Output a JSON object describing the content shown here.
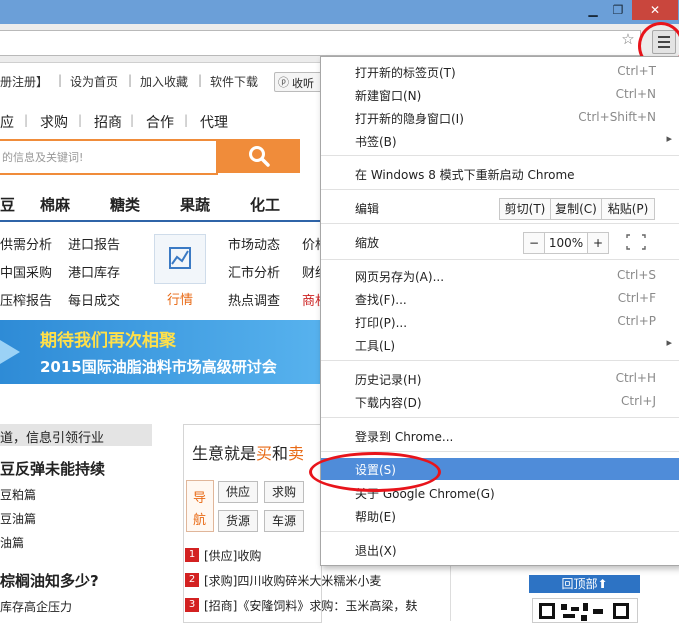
{
  "window": {
    "minimize_icon": "minimize-icon",
    "maximize_icon": "restore-icon",
    "close_label": "✕",
    "restore_label": "❐",
    "minimize_label": "▁"
  },
  "toolbar": {
    "star_label": "☆"
  },
  "site": {
    "top_nav": [
      "册注册】",
      "设为首页",
      "加入收藏",
      "软件下载",
      "收听"
    ],
    "top_nav_seps": [
      "|",
      "|",
      "|"
    ],
    "categories": [
      "应",
      "求购",
      "招商",
      "合作",
      "代理"
    ],
    "search_placeholder": "的信息及关键词!",
    "goods_tabs": [
      "豆",
      "棉麻",
      "糖类",
      "果蔬",
      "化工"
    ],
    "subnav_col1": [
      "供需分析",
      "中国采购",
      "压榨报告"
    ],
    "subnav_col2": [
      "进口报告",
      "港口库存",
      "每日成交"
    ],
    "subnav_col3": [
      "市场动态",
      "汇市分析",
      "热点调查"
    ],
    "subnav_col4": [
      "价格",
      "财经",
      "商机"
    ],
    "quotes_label": "行情",
    "banner_line1": "期待我们再次相聚",
    "banner_line2": "2015国际油脂油料市场高级研讨会",
    "info_strip": "道，信息引领行业",
    "news": [
      {
        "head": "豆反弹未能持续",
        "items": [
          "豆粕篇",
          "豆油篇",
          "油篇"
        ]
      },
      {
        "head": "棕榈油知多少?",
        "items": [
          "库存高企压力"
        ]
      }
    ],
    "biz_title_pre": "生意就是",
    "biz_title_hl1": "买",
    "biz_title_mid": "和",
    "biz_title_hl2": "卖",
    "nav_tag": [
      "导",
      "航"
    ],
    "tag_buttons": [
      "供应",
      "求购",
      "货源",
      "车源"
    ],
    "supply_list": [
      {
        "num": "1",
        "text": "[供应]收购"
      },
      {
        "num": "2",
        "text": "[求购]四川收购碎米大米糯米小麦"
      },
      {
        "num": "3",
        "text": "[招商]《安隆饲料》求购：玉米高梁，麸"
      }
    ],
    "back_top": "回顶部⬆"
  },
  "menu": {
    "items": [
      {
        "label": "打开新的标签页(T)",
        "shortcut": "Ctrl+T"
      },
      {
        "label": "新建窗口(N)",
        "shortcut": "Ctrl+N"
      },
      {
        "label": "打开新的隐身窗口(I)",
        "shortcut": "Ctrl+Shift+N"
      },
      {
        "label": "书签(B)",
        "arrow": "▸"
      },
      {
        "label": "在 Windows 8 模式下重新启动 Chrome"
      },
      {
        "label": "编辑"
      },
      {
        "label": "缩放"
      },
      {
        "label": "网页另存为(A)...",
        "shortcut": "Ctrl+S"
      },
      {
        "label": "查找(F)...",
        "shortcut": "Ctrl+F"
      },
      {
        "label": "打印(P)...",
        "shortcut": "Ctrl+P"
      },
      {
        "label": "工具(L)",
        "arrow": "▸"
      },
      {
        "label": "历史记录(H)",
        "shortcut": "Ctrl+H"
      },
      {
        "label": "下载内容(D)",
        "shortcut": "Ctrl+J"
      },
      {
        "label": "登录到 Chrome..."
      },
      {
        "label": "设置(S)"
      },
      {
        "label": "关于 Google Chrome(G)"
      },
      {
        "label": "帮助(E)"
      },
      {
        "label": "退出(X)"
      }
    ],
    "edit_buttons": [
      "剪切(T)",
      "复制(C)",
      "粘贴(P)"
    ],
    "zoom_minus": "−",
    "zoom_value": "100%",
    "zoom_plus": "+",
    "fullscreen_icon": "⛶"
  }
}
